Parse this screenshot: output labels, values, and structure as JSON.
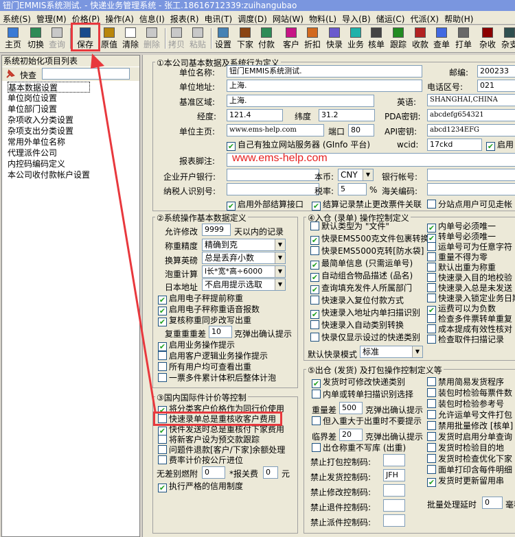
{
  "window": {
    "title": "钮门EMMIS系统测试. - 快递业务管理系统 - 张工.18616712339:zuihangubao"
  },
  "menu": [
    "系统(S)",
    "管理(M)",
    "价格(P)",
    "操作(A)",
    "信息(I)",
    "报表(R)",
    "电讯(T)",
    "调度(D)",
    "网站(W)",
    "物料(L)",
    "导入(B)",
    "储运(C)",
    "代派(X)",
    "帮助(H)"
  ],
  "toolbar": [
    {
      "label": "主页",
      "icon": "home-icon",
      "enabled": true
    },
    {
      "label": "切换",
      "icon": "switch-icon",
      "enabled": true
    },
    {
      "label": "查询",
      "icon": "binoculars-icon",
      "enabled": false
    },
    {
      "label": "保存",
      "icon": "save-icon",
      "enabled": true
    },
    {
      "label": "原值",
      "icon": "revert-icon",
      "enabled": true
    },
    {
      "label": "清除",
      "icon": "clear-icon",
      "enabled": true
    },
    {
      "label": "删除",
      "icon": "delete-icon",
      "enabled": false
    },
    {
      "label": "拷贝",
      "icon": "copy-icon",
      "enabled": false
    },
    {
      "label": "粘贴",
      "icon": "paste-icon",
      "enabled": false
    },
    {
      "label": "设置",
      "icon": "settings-icon",
      "enabled": true
    },
    {
      "label": "下家",
      "icon": "downstream-icon",
      "enabled": true
    },
    {
      "label": "付款",
      "icon": "payment-icon",
      "enabled": true
    },
    {
      "label": "客户",
      "icon": "customer-icon",
      "enabled": true
    },
    {
      "label": "折扣",
      "icon": "discount-icon",
      "enabled": true
    },
    {
      "label": "快录",
      "icon": "quick-entry-icon",
      "enabled": true
    },
    {
      "label": "业务",
      "icon": "business-icon",
      "enabled": true
    },
    {
      "label": "核单",
      "icon": "verify-icon",
      "enabled": true
    },
    {
      "label": "跟踪",
      "icon": "tracking-icon",
      "enabled": true
    },
    {
      "label": "收款",
      "icon": "receipt-icon",
      "enabled": true
    },
    {
      "label": "查单",
      "icon": "lookup-icon",
      "enabled": true
    },
    {
      "label": "打单",
      "icon": "print-icon",
      "enabled": true
    },
    {
      "label": "杂收",
      "icon": "misc-income-icon",
      "enabled": true
    },
    {
      "label": "杂支",
      "icon": "misc-expense-icon",
      "enabled": true
    }
  ],
  "left_panel": {
    "title": "系统初始化项目列表",
    "search_label": "快查",
    "search_value": "",
    "items": [
      "基本数据设置",
      "单位岗位设置",
      "单位部门设置",
      "杂项收入分类设置",
      "杂项支出分类设置",
      "常用外单位名称",
      "代理派件公司",
      "内控码编码定义",
      "本公司收付款帐户设置"
    ]
  },
  "group1": {
    "title": "①本公司基本数据及系统行为定义",
    "company_name_label": "单位名称:",
    "company_name": "钮门EMMIS系统测试.",
    "postcode_label": "邮编:",
    "postcode": "200233",
    "address_label": "单位地址:",
    "address": "上海.",
    "area_code_label": "电话区号:",
    "area_code": "021",
    "base_area_label": "基准区域:",
    "base_area": "上海.",
    "english_label": "英语:",
    "english": "SHANGHAI,CHINA",
    "longitude_label": "经度:",
    "longitude": "121.4",
    "latitude_label": "纬度",
    "latitude": "31.2",
    "pda_key_label": "PDA密钥:",
    "pda_key": "abcdefg654321",
    "homepage_label": "单位主页:",
    "homepage": "www.ems-help.com",
    "port_label": "端口",
    "port": "80",
    "api_key_label": "API密钥:",
    "api_key": "abcd1234EFG",
    "own_server_label": "自己有独立网站服务器 (GInfo 平台)",
    "wcid_label": "wcid:",
    "wcid": "17ckd",
    "enable_label": "启用",
    "footer_label": "报表脚注:",
    "footer": "",
    "watermark": "www.ems-help.com",
    "bank_label": "企业开户银行:",
    "bank": "",
    "currency_label": "本币:",
    "currency": "CNY",
    "bank_account_label": "银行帐号:",
    "bank_account": "",
    "taxpayer_label": "纳税人识别号:",
    "taxpayer": "",
    "tax_rate_label": "税率:",
    "tax_rate": "5",
    "percent": "%",
    "customs_code_label": "海关编码:",
    "customs_code": "",
    "ext_settle_label": "启用外部结算接口",
    "settle_lock_label": "结算记录禁止更改票件关联",
    "branch_visible_label": "分站点用户可见走帐"
  },
  "group2": {
    "title": "②系统操作基本数据定义",
    "allow_modify_label": "允许修改",
    "allow_modify_days": "9999",
    "allow_modify_suffix": "天以内的记录",
    "weigh_precision_label": "称重精度",
    "weigh_precision": "精确到克",
    "conversion_label": "换算英磅",
    "conversion": "总是丢弃小数",
    "bubble_label": "泡重计算",
    "bubble": "l长*宽*高÷6000",
    "japan_addr_label": "日本地址",
    "japan_addr": "不启用提示选取",
    "checks": [
      {
        "label": "启用电子秤提前称重",
        "checked": true
      },
      {
        "label": "启用电子秤称重语音报数",
        "checked": true
      },
      {
        "label": "复核称重同步改写出重",
        "checked": true
      }
    ],
    "recheck_label": "复重重重差",
    "recheck_value": "10",
    "recheck_suffix": "克弹出确认提示",
    "checks2": [
      {
        "label": "启用业务操作提示",
        "checked": true
      },
      {
        "label": "启用客户逻辑业务操作提示",
        "checked": false
      },
      {
        "label": "所有用户均可查看出重",
        "checked": false
      },
      {
        "label": "一票多件累计体积后整体计泡",
        "checked": false
      }
    ]
  },
  "group3": {
    "title": "③国内国际件计价等控制",
    "checks": [
      {
        "label": "将分类客户价格作为同行价使用",
        "checked": true
      },
      {
        "label": "快速录单总是重核收客户费用",
        "checked": false
      },
      {
        "label": "快件发送时总是重核付下家费用",
        "checked": true
      },
      {
        "label": "将新客户设为预交款跟踪",
        "checked": false
      },
      {
        "label": "问题件退款[客户/下家]余额处理",
        "checked": false
      },
      {
        "label": "费率计价按公斤进位",
        "checked": false
      }
    ],
    "no_diff_label": "无差别燃附",
    "no_diff_value": "0",
    "declare_fee_label": "*报关费",
    "declare_fee_value": "0",
    "yuan": "元",
    "strict_credit_label": "执行严格的信用制度",
    "strict_credit": true
  },
  "group4": {
    "title": "④入仓 (录单) 操作控制定义",
    "left_checks": [
      {
        "label": "默认类型为 \"文件\"",
        "checked": false
      },
      {
        "label": "快录EMS500克文件包裹转换",
        "checked": true
      },
      {
        "label": "快录EMS5000克转[防水袋]",
        "checked": false
      },
      {
        "label": "最简单信息 (只需运单号)",
        "checked": true
      },
      {
        "label": "自动组合物品描述 (品名)",
        "checked": true
      },
      {
        "label": "查询填充发件人所属部门",
        "checked": true
      },
      {
        "label": "快速录入复位付款方式",
        "checked": false
      },
      {
        "label": "快速录入地址内单扫描识别",
        "checked": true
      },
      {
        "label": "快速录入自动类别转换",
        "checked": false
      },
      {
        "label": "快录仅显示设过的快递类别",
        "checked": false
      }
    ],
    "right_checks": [
      {
        "label": "内单号必须唯一",
        "checked": true
      },
      {
        "label": "转单号必须唯一",
        "checked": true
      },
      {
        "label": "运单号可为任意字符",
        "checked": false
      },
      {
        "label": "重量不得为零",
        "checked": false
      },
      {
        "label": "默认出重为称重",
        "checked": false
      },
      {
        "label": "快速录入目的地校验",
        "checked": false
      },
      {
        "label": "快速录入总是未发送",
        "checked": false
      },
      {
        "label": "快速录入锁定业务日期",
        "checked": false
      },
      {
        "label": "运费可以为负数",
        "checked": true
      },
      {
        "label": "检查多件票转单重复",
        "checked": false
      },
      {
        "label": "成本提成有效性核对",
        "checked": false
      },
      {
        "label": "检查取件扫描记录",
        "checked": false
      }
    ],
    "default_mode_label": "默认快录模式",
    "default_mode": "标准"
  },
  "group5": {
    "title": "⑤出仓 (发货) 及打包操作控制定义等",
    "left_checks": [
      {
        "label": "发货时可修改快递类别",
        "checked": true
      },
      {
        "label": "内单或转单扫描识别选择",
        "checked": false
      }
    ],
    "weight_diff_label": "重量差",
    "weight_diff_value": "500",
    "weight_diff_suffix": "克弹出确认提示",
    "over_weight_label": "但入重大于出重时不要提示",
    "over_weight": false,
    "critical_label": "临界差",
    "critical_value": "20",
    "critical_suffix": "克弹出确认提示",
    "out_scale_label": "出仓称重不写库 (出重)",
    "out_scale": false,
    "ban_pack_label": "禁止打包控制码:",
    "ban_ship_label": "禁止发货控制码:",
    "ban_ship_value": "JFH",
    "ban_modify_label": "禁止修改控制码:",
    "ban_return_label": "禁止退件控制码:",
    "ban_dispatch_label": "禁止派件控制码:",
    "right_checks": [
      {
        "label": "禁用简易发货程序",
        "checked": false
      },
      {
        "label": "装包时检验每票件数",
        "checked": false
      },
      {
        "label": "装包时检验参考号",
        "checked": false
      },
      {
        "label": "允许运单号文件打包",
        "checked": false
      },
      {
        "label": "禁用批量修改 [核单]",
        "checked": false
      },
      {
        "label": "发货时启用分单查询",
        "checked": false
      },
      {
        "label": "发货时检验目的地",
        "checked": false
      },
      {
        "label": "发货时检查优化下家",
        "checked": false
      },
      {
        "label": "面单打印含每件明细",
        "checked": false
      },
      {
        "label": "发货时更新留用串",
        "checked": true
      }
    ],
    "batch_delay_label": "批量处理延时",
    "batch_delay_value": "0",
    "batch_delay_suffix": "毫秒"
  },
  "colors": {
    "highlight": "#e8383d",
    "watermark": "#e62020",
    "titlebar": "#7a96df"
  }
}
